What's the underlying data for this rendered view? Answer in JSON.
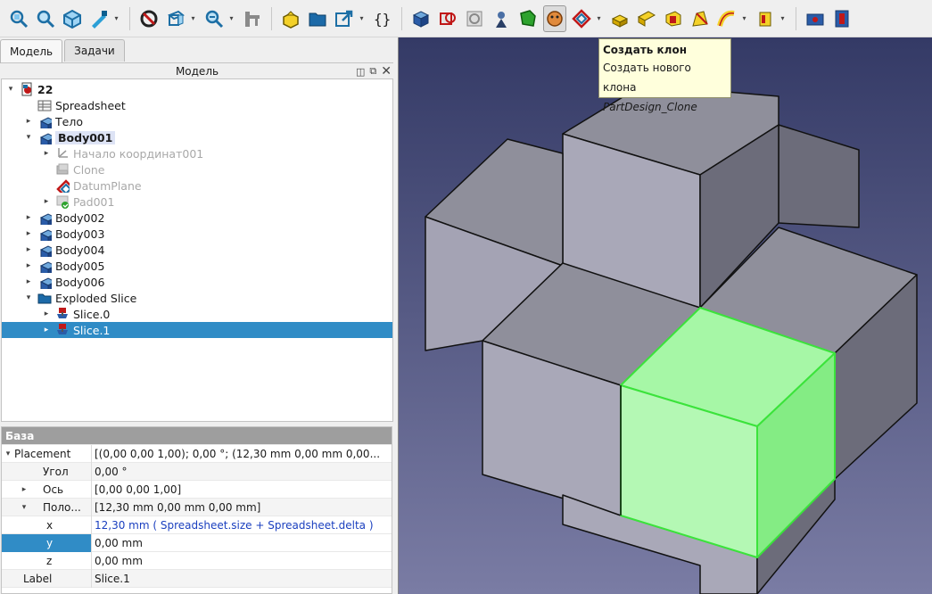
{
  "toolbar": {
    "icons": [
      "fit-all-icon",
      "fit-selection-icon",
      "isometric-view-icon",
      "measure-icon",
      "draw-style-icon",
      "bounding-box-icon",
      "zoom-icon",
      "measure-distance-icon",
      "part-icon",
      "group-icon",
      "link-icon",
      "macro-icon",
      "body-icon",
      "sketch-icon",
      "validate-sketch-icon",
      "attach-icon",
      "subshape-binder-icon",
      "clone-icon",
      "datum-plane-icon",
      "pad-icon",
      "pocket-icon",
      "revolve-icon",
      "loft-icon",
      "pipe-icon",
      "additive-box-icon",
      "hole-icon",
      "groove-icon"
    ]
  },
  "tabs": [
    {
      "label": "Модель",
      "selected": true
    },
    {
      "label": "Задачи",
      "selected": false
    }
  ],
  "model_header": "Модель",
  "tree": [
    {
      "label": "22",
      "level": 0,
      "arrow": "down",
      "icon": "document-icon",
      "style": "bold"
    },
    {
      "label": "Spreadsheet",
      "level": 1,
      "arrow": "",
      "icon": "spreadsheet-icon",
      "style": ""
    },
    {
      "label": "Тело",
      "level": 1,
      "arrow": "right",
      "icon": "body-icon",
      "style": ""
    },
    {
      "label": "Body001",
      "level": 1,
      "arrow": "down",
      "icon": "body-icon",
      "style": "bold-hl"
    },
    {
      "label": "Начало координат001",
      "level": 2,
      "arrow": "right",
      "icon": "origin-icon",
      "style": "grey"
    },
    {
      "label": "Clone",
      "level": 2,
      "arrow": "",
      "icon": "clone-feature-icon",
      "style": "grey"
    },
    {
      "label": "DatumPlane",
      "level": 2,
      "arrow": "",
      "icon": "datum-plane-icon",
      "style": "grey"
    },
    {
      "label": "Pad001",
      "level": 2,
      "arrow": "right",
      "icon": "pad-feature-icon",
      "style": "grey"
    },
    {
      "label": "Body002",
      "level": 1,
      "arrow": "right",
      "icon": "body-icon",
      "style": ""
    },
    {
      "label": "Body003",
      "level": 1,
      "arrow": "right",
      "icon": "body-icon",
      "style": ""
    },
    {
      "label": "Body004",
      "level": 1,
      "arrow": "right",
      "icon": "body-icon",
      "style": ""
    },
    {
      "label": "Body005",
      "level": 1,
      "arrow": "right",
      "icon": "body-icon",
      "style": ""
    },
    {
      "label": "Body006",
      "level": 1,
      "arrow": "right",
      "icon": "body-icon",
      "style": ""
    },
    {
      "label": "Exploded Slice",
      "level": 1,
      "arrow": "down",
      "icon": "folder-icon",
      "style": ""
    },
    {
      "label": "Slice.0",
      "level": 2,
      "arrow": "right",
      "icon": "slice-icon",
      "style": ""
    },
    {
      "label": "Slice.1",
      "level": 2,
      "arrow": "right",
      "icon": "slice-icon",
      "style": "selected"
    }
  ],
  "props": {
    "group": "База",
    "rows": [
      {
        "name": "Placement",
        "arrow": "down",
        "indent": 0,
        "value": "[(0,00 0,00 1,00); 0,00 °; (12,30 mm  0,00 mm  0,00...",
        "style": ""
      },
      {
        "name": "Угол",
        "arrow": "",
        "indent": 1,
        "value": "0,00 °",
        "style": "alt"
      },
      {
        "name": "Ось",
        "arrow": "right",
        "indent": 1,
        "value": "[0,00 0,00 1,00]",
        "style": ""
      },
      {
        "name": "Поло...",
        "arrow": "down",
        "indent": 1,
        "value": "[12,30 mm  0,00 mm  0,00 mm]",
        "style": "alt"
      },
      {
        "name": "x",
        "arrow": "",
        "indent": 2,
        "value": "12,30 mm  ( Spreadsheet.size + Spreadsheet.delta )",
        "style": "expr"
      },
      {
        "name": "y",
        "arrow": "",
        "indent": 2,
        "value": "0,00 mm",
        "style": "sel"
      },
      {
        "name": "z",
        "arrow": "",
        "indent": 2,
        "value": "0,00 mm",
        "style": ""
      },
      {
        "name": "Label",
        "arrow": "",
        "indent": 0,
        "value": "Slice.1",
        "style": "alt"
      }
    ]
  },
  "tooltip": {
    "title": "Создать клон",
    "description": "Создать нового клона",
    "command": "PartDesign_Clone"
  },
  "colors": {
    "selection": "#308cc6",
    "highlight_face": "#a6f7a6",
    "face_top": "#8f8f9c",
    "face_front": "#a9a8b8",
    "face_side": "#6a6a78"
  }
}
